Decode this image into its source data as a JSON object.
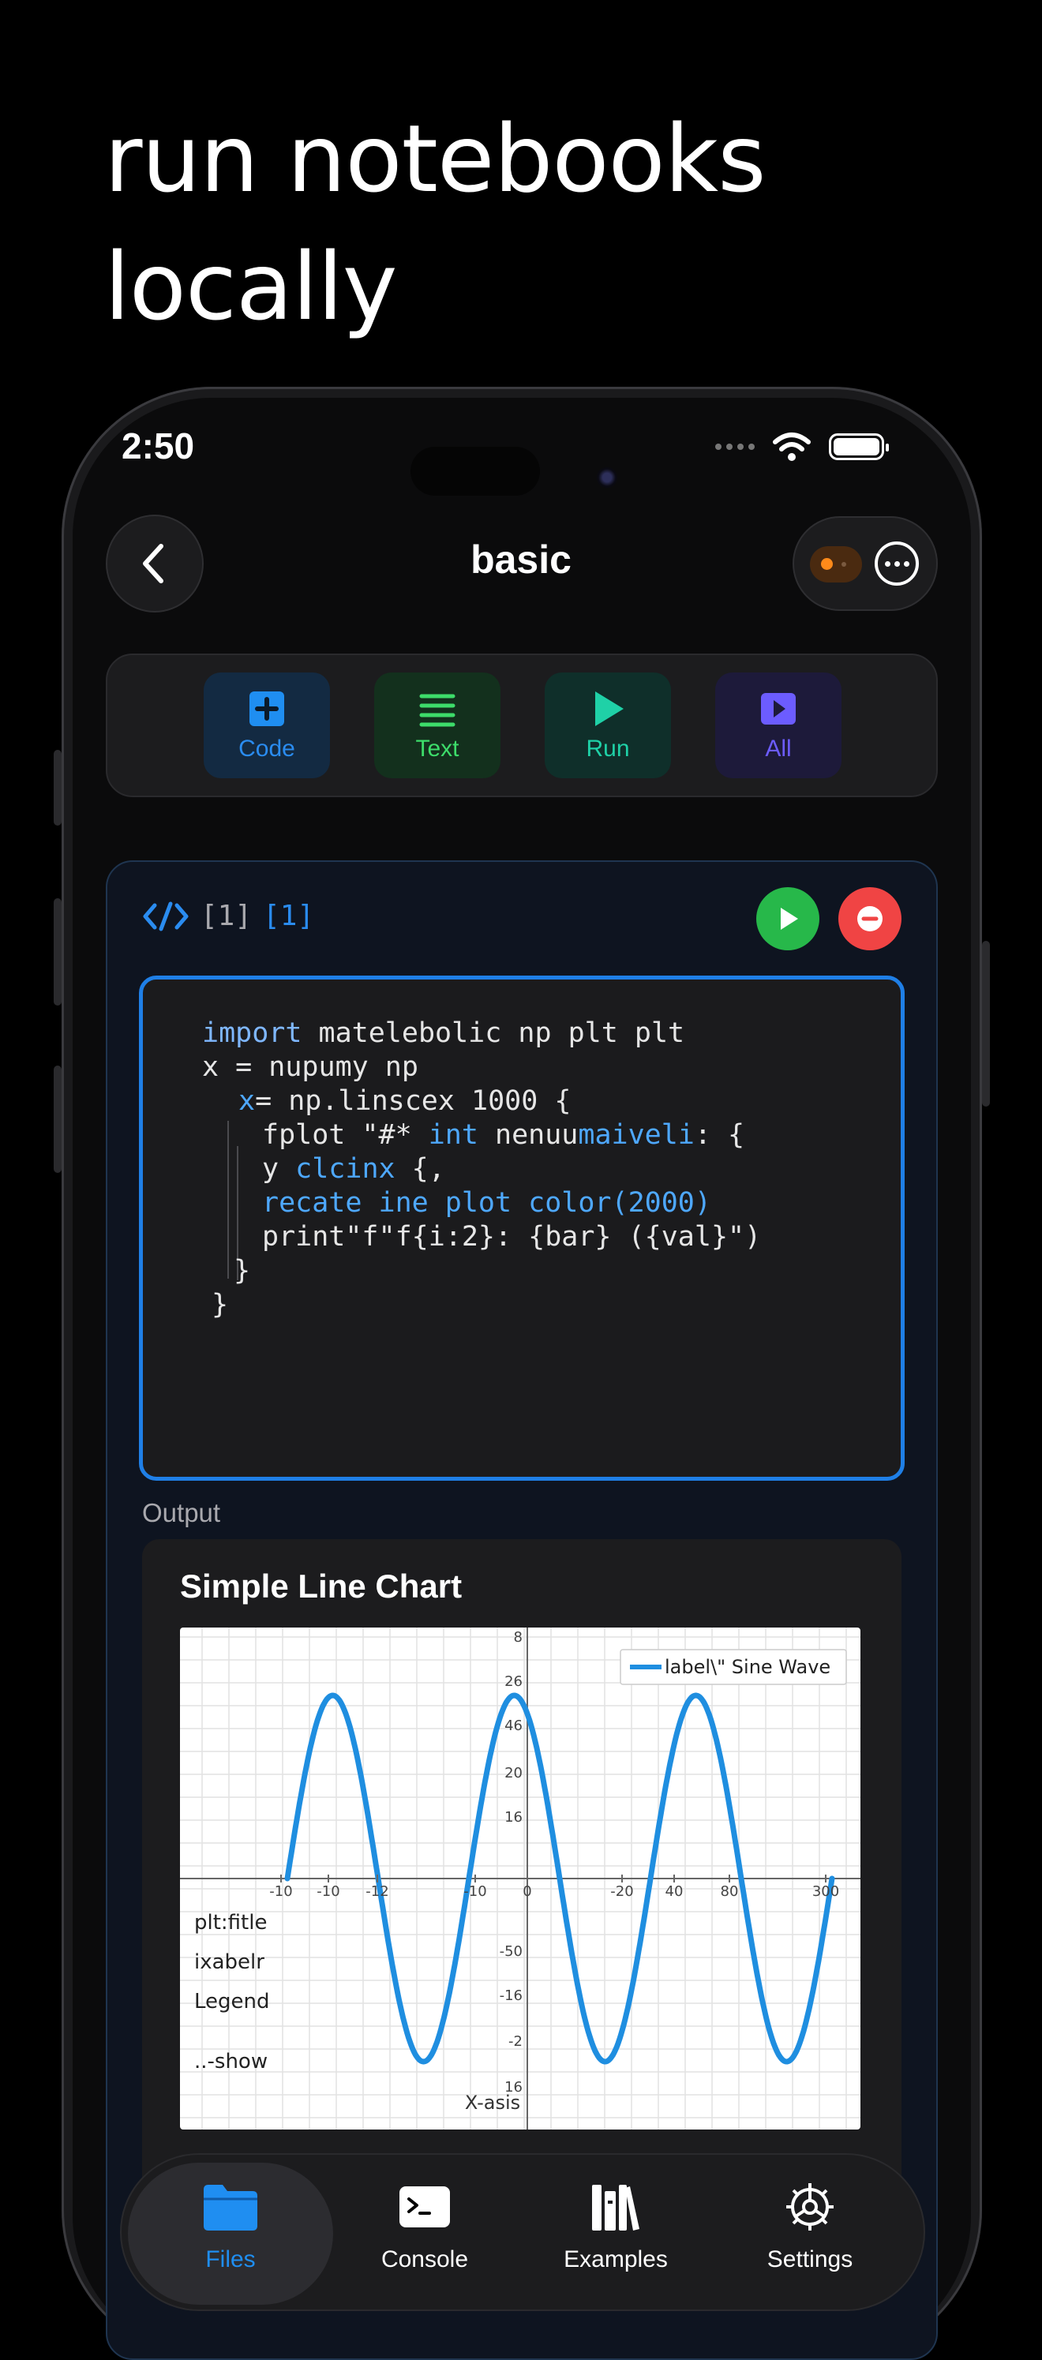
{
  "headline": {
    "line1": "run notebooks",
    "line2": "locally"
  },
  "status_bar": {
    "time": "2:50"
  },
  "nav": {
    "title": "basic"
  },
  "toolbar": {
    "code_label": "Code",
    "text_label": "Text",
    "run_label": "Run",
    "all_label": "All"
  },
  "cell": {
    "exec_count_a": "[1]",
    "exec_count_b": "[1]",
    "code_lines": [
      "import matelebolic np plt plt",
      "x = nupumy np",
      "x= np.linscex 1000 {",
      "fplot \"#* int nenuumaiveli: {",
      "y clcinx {,",
      "recate ine plot color(2000)",
      "print\"f\"f{i:2}: {bar} ({val}\")",
      "}",
      "}"
    ]
  },
  "output": {
    "label": "Output",
    "side_text": [
      "plt:fitle",
      "ixabelr",
      "Legend",
      "..-show"
    ]
  },
  "chart_data": {
    "type": "line",
    "title": "Simple Line Chart",
    "xlabel": "X-asis",
    "ylabel": "",
    "x_tick_labels": [
      "-10",
      "-10",
      "-12",
      "-10",
      "0",
      "-20",
      "40",
      "80",
      "300"
    ],
    "y_tick_labels_upper": [
      "8",
      "26",
      "46",
      "20",
      "16"
    ],
    "y_tick_labels_lower": [
      "-50",
      "-16",
      "-2",
      "16"
    ],
    "series": [
      {
        "name": "label\\\" Sine Wave",
        "color": "#1f8ee0",
        "shape": "sine",
        "cycles": 3,
        "amplitude": 1
      }
    ],
    "grid": true,
    "legend_position": "top-right"
  },
  "tabbar": {
    "files": "Files",
    "console": "Console",
    "examples": "Examples",
    "settings": "Settings",
    "active": "Files"
  },
  "colors": {
    "accent_blue": "#1f8ef1",
    "code_green": "#3ddc6a",
    "run_teal": "#1fd1a7",
    "all_purple": "#6c5cff",
    "run_button": "#27b84a",
    "stop_button": "#f04444",
    "cell_border": "#1f7fe6"
  }
}
